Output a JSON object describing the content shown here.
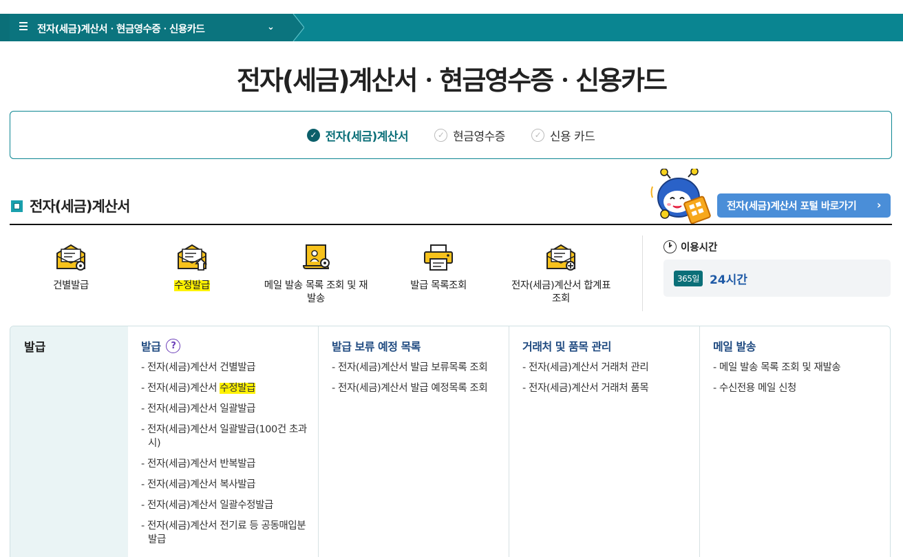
{
  "breadcrumb": {
    "label": "전자(세금)계산서ㆍ현금영수증ㆍ신용카드",
    "chevron": "⌄"
  },
  "page_title": "전자(세금)계산서ㆍ현금영수증ㆍ신용카드",
  "tabs": [
    {
      "label": "전자(세금)계산서",
      "active": true
    },
    {
      "label": "현금영수증",
      "active": false
    },
    {
      "label": "신용 카드",
      "active": false
    }
  ],
  "section": {
    "title": "전자(세금)계산서",
    "portal_button": "전자(세금)계산서 포털 바로가기",
    "portal_arrow": "›"
  },
  "quick_menu": [
    {
      "label": "건별발급",
      "icon": "envelope-gear-icon"
    },
    {
      "label": "수정발급",
      "icon": "envelope-upload-icon",
      "highlight": true
    },
    {
      "label": "메일 발송 목록 조회 및 재발송",
      "icon": "scroll-search-icon"
    },
    {
      "label": "발급 목록조회",
      "icon": "printer-icon"
    },
    {
      "label": "전자(세금)계산서 합계표 조회",
      "icon": "envelope-plus-icon"
    }
  ],
  "hours": {
    "title": "이용시간",
    "badge": "365일",
    "value": "24시간"
  },
  "panel": {
    "side_title": "발급",
    "columns": [
      {
        "heading": "발급",
        "help": "?",
        "items": [
          {
            "text": "- 전자(세금)계산서 건별발급"
          },
          {
            "text_pre": "- 전자(세금)계산서 ",
            "text_hl": "수정발급"
          },
          {
            "text": "- 전자(세금)계산서 일괄발급"
          },
          {
            "text": "- 전자(세금)계산서 일괄발급(100건 초과 시)"
          },
          {
            "text": "- 전자(세금)계산서 반복발급"
          },
          {
            "text": "- 전자(세금)계산서 복사발급"
          },
          {
            "text": "- 전자(세금)계산서 일괄수정발급"
          },
          {
            "text": "- 전자(세금)계산서 전기료 등 공동매입분 발급"
          }
        ]
      },
      {
        "heading": "발급 보류 예정 목록",
        "items": [
          {
            "text": "- 전자(세금)계산서 발급 보류목록 조회"
          },
          {
            "text": "- 전자(세금)계산서 발급 예정목록 조회"
          }
        ]
      },
      {
        "heading": "거래처 및 품목 관리",
        "items": [
          {
            "text": "- 전자(세금)계산서 거래처 관리"
          },
          {
            "text": "- 전자(세금)계산서 거래처 품목"
          }
        ]
      },
      {
        "heading": "메일 발송",
        "items": [
          {
            "text": "- 메일 발송 목록 조회 및 재발송"
          },
          {
            "text": "- 수신전용 메일 신청"
          }
        ]
      }
    ]
  },
  "colors": {
    "teal": "#0a8591",
    "teal_dark": "#0b747e",
    "blue_button": "#4a8ed8",
    "highlight": "#fff200",
    "heading_blue": "#1f4a80"
  }
}
